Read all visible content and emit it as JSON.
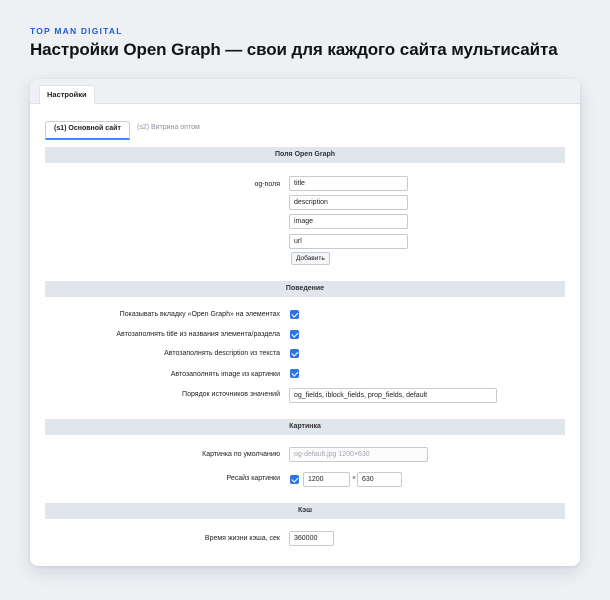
{
  "brand": "TOP MAN DIGITAL",
  "headline": "Настройки Open Graph — свои для каждого сайта мультисайта",
  "main_tab": "Настройки",
  "site_tabs": [
    "(s1) Основной сайт",
    "(s2) Витрина оптом"
  ],
  "sections": {
    "og": "Поля Open Graph",
    "behavior": "Поведение",
    "image": "Картинка",
    "cache": "Кэш"
  },
  "og_fields": {
    "label": "og-поля",
    "values": [
      "title",
      "description",
      "image",
      "url"
    ],
    "add_button": "Добавить"
  },
  "behavior": {
    "items": [
      {
        "label": "Показывать вкладку «Open Graph» на элементах",
        "checked": true
      },
      {
        "label": "Автозаполнять title из названия элемента/раздела",
        "checked": true
      },
      {
        "label": "Автозаполнять description из текста",
        "checked": true
      },
      {
        "label": "Автозаполнять image из картинки",
        "checked": true
      }
    ],
    "order_label": "Порядок источников значений",
    "order_value": "og_fields, iblock_fields, prop_fields, default"
  },
  "image": {
    "default_label": "Картинка по умолчанию",
    "default_placeholder": "og-default.jpg   1200×630",
    "resize_label": "Ресайз картинки",
    "resize_checked": true,
    "width": "1200",
    "times": "×",
    "height": "630"
  },
  "cache": {
    "ttl_label": "Время жизни кэша, сек",
    "ttl_value": "360000"
  },
  "colors": {
    "accent": "#2f73e8",
    "brand": "#1d5fd1",
    "section_bg": "#e1e5ec"
  }
}
